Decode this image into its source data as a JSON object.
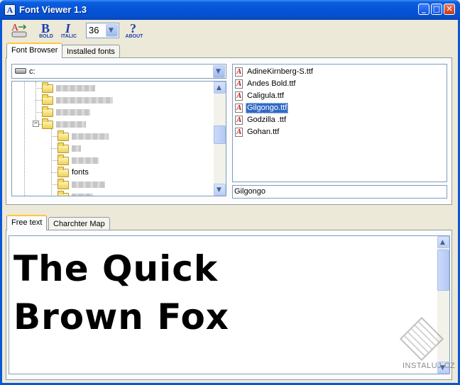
{
  "window": {
    "title": "Font Viewer 1.3",
    "icon": "font-viewer-app-icon",
    "controls": {
      "minimize": "minimize-icon",
      "maximize": "maximize-icon",
      "close": "close-icon"
    }
  },
  "toolbar": {
    "font_tool_label": "",
    "bold_label": "BOLD",
    "italic_label": "ITALIC",
    "about_label": "ABOUT",
    "font_size": "36"
  },
  "top_tabs": [
    {
      "label": "Font Browser",
      "active": true
    },
    {
      "label": "Installed fonts",
      "active": false
    }
  ],
  "browser": {
    "drive": "c:",
    "tree_visible_label": "fonts",
    "files": [
      {
        "name": "AdineKirnberg-S.ttf",
        "selected": false
      },
      {
        "name": "Andes Bold.ttf",
        "selected": false
      },
      {
        "name": "Caligula.ttf",
        "selected": false
      },
      {
        "name": "Gilgongo.ttf",
        "selected": true
      },
      {
        "name": "Godzilla .ttf",
        "selected": false
      },
      {
        "name": "Gohan.ttf",
        "selected": false
      }
    ],
    "selected_font_name": "Gilgongo"
  },
  "bottom_tabs": [
    {
      "label": "Free text",
      "active": true
    },
    {
      "label": "Charchter Map",
      "active": false
    }
  ],
  "preview": {
    "text": "The Quick\nBrown Fox"
  },
  "watermark": {
    "text": "INSTALUJ.CZ"
  },
  "colors": {
    "titlebar": "#0a57d6",
    "selection": "#316ac5",
    "tab_highlight": "#ffc83c"
  }
}
